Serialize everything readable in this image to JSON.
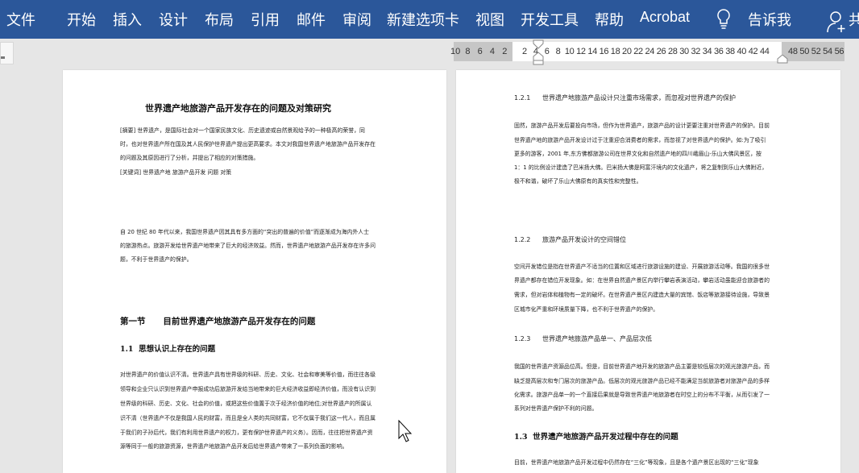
{
  "ribbon": {
    "tabs": [
      "文件",
      "开始",
      "插入",
      "设计",
      "布局",
      "引用",
      "邮件",
      "审阅",
      "新建选项卡",
      "视图",
      "开发工具",
      "帮助",
      "Acrobat"
    ],
    "tell_me": "告诉我",
    "share": "共",
    "bulb_icon": "lightbulb-icon",
    "share_icon": "add-person-icon",
    "color": "#2b579a"
  },
  "ruler": {
    "left_numbers": "10  8   6   4   2",
    "main_numbers": "2   4   6   8  10 12 14 16 18 20 22 24 26 28 30 32 34 36 38 40 42 44",
    "right_numbers": "48 50 52 54 56"
  },
  "left_page": {
    "title": "世界遗产地旅游产品开发存在的问题及对策研究",
    "abstract": [
      "[摘要] 世界遗产，是国际社会对一个国家民族文化、历史遗迹或自然景观给予的一种极高的荣誉，同",
      "时，也对世界遗产所在国及其人民保护世界遗产提出更高要求。本文对我国世界遗产地旅游产品开发存在",
      "的问题及其原因进行了分析，并提出了相应的对策措施。"
    ],
    "keywords": "[关键词] 世界遗产地   旅游产品开发   问题   对策",
    "intro": [
      "自 20 世纪 80 年代以来，我国世界遗产因其具有多方面的“突出的普遍的价值”而逐渐成为海内外人士",
      "的旅游热点。旅游开发给世界遗产地带来了巨大的经济效益。然而，世界遗产地旅游产品开发存在许多问",
      "题，不利于世界遗产的保护。"
    ],
    "section_title": "第一节      目前世界遗产地旅游产品开发存在的问题",
    "subsection_title": "1.1  思想认识上存在的问题",
    "body": [
      "对世界遗产的价值认识不清。世界遗产具有世界级的科研、历史、文化、社会和审美等价值，而往往各级",
      "领导和企业只认识到世界遗产申报成功后旅游开发给当地带来的巨大经济收益即经济价值，而没有认识到",
      "世界级的科研、历史、文化、社会的价值，或把这些价值置于次于经济价值的地位;对世界遗产的所属认",
      "识不清（世界遗产不仅是我国人民的财富，而且是全人类的共同财富，它不仅属于我们这一代人，而且属",
      "于我们的子孙后代，我们有利用世界遗产的权力，更有保护世界遗产的义务）。因而，往往把世界遗产资",
      "源等同于一般的旅游资源，世界遗产地旅游产品开发后给世界遗产带来了一系列负面的影响。"
    ]
  },
  "right_page": {
    "s121_num": "1.2.1",
    "s121_title": "世界遗产地旅游产品设计只注重市场需求，而忽视对世界遗产的保护",
    "p121": [
      "固然，旅游产品开发后要投向市场，但作为世界遗产，旅游产品的设计更要注重对世界遗产的保护。目前",
      "世界遗产地的旅游产品开发设计过于注重迎合消费者的需求，而忽视了对世界遗产的保护。如:为了吸引",
      "更多的游客，2001 年,东方佛都旅游公司在世界文化和自然遗产地的四川峨眉山-乐山大佛风景区，按",
      "1：1  的比例设计建造了巴米扬大佛。巴米扬大佛是阿富汗境内的文化遗产，将之复制到乐山大佛附近，",
      "极不和谐，破坏了乐山大佛原有的真实性和完整性。"
    ],
    "s122_num": "1.2.2",
    "s122_title": "旅游产品开发设计的空间错位",
    "p122": [
      "空间开发错位是指在世界遗产不适当的位置和区域进行旅游设施的建设、开展旅游活动等。我国的很多世",
      "界遗产都存在错位开发现象。如：在世界自然遗产景区内举行攀岩表演活动，攀岩活动虽能迎合旅游者的",
      "需求，但对岩体和植物有一定的破坏。在世界遗产景区内建造大量的宾馆、饭店等旅游接待设施，导致景",
      "区城市化严重和环境质量下降，也不利于世界遗产的保护。"
    ],
    "s123_num": "1.2.3",
    "s123_title": "世界遗产地旅游产品单一、产品层次低",
    "p123": [
      "我国的世界遗产资源品位高。但是，目前世界遗产地开发的旅游产品主要是较低层次的观光旅游产品，而",
      "缺乏提高层次和专门层次的旅游产品。低层次的观光旅游产品已经不能满足当前旅游者对旅游产品的多样",
      "化需求。旅游产品单一的一个直接后果就是导致世界遗产地旅游者在时空上的分布不平衡，从而引发了一",
      "系列对世界遗产保护不利的问题。"
    ],
    "s13_title": "1.3  世界遗产地旅游产品开发过程中存在的问题",
    "p13": [
      "目前，世界遗产地旅游产品开发过程中仍然存在“三化”等现象，且是各个遗产景区出现的“三化”现象"
    ]
  }
}
